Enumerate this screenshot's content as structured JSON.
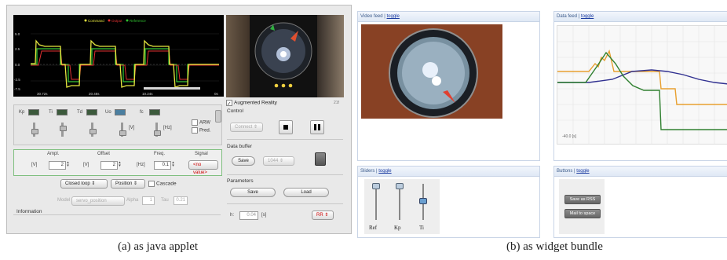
{
  "captions": {
    "left": "(a) as java applet",
    "right": "(b) as widget bundle"
  },
  "applet": {
    "scope": {
      "legend": [
        "Command",
        "Output",
        "Reference"
      ],
      "legend_colors": [
        "#e8e840",
        "#e03030",
        "#30c030"
      ],
      "y_ticks": [
        "5.0",
        "2.5",
        "0.0",
        "-2.5",
        "-5.0",
        "-7.5"
      ],
      "x_ticks": [
        "30.72s",
        "20.48s",
        "10.24s",
        "0s"
      ]
    },
    "augmented_reality_label": "Augmented Reality",
    "ar_value": "21f",
    "gains": {
      "labels": [
        "Kp",
        "Ti",
        "Td",
        "Uo",
        "fc"
      ],
      "units": [
        "[V]",
        "[Hz]"
      ],
      "checkboxes": [
        "ARW",
        "Pred."
      ]
    },
    "signal": {
      "headers": [
        "Ampl.",
        "Offset",
        "Freq.",
        "Signal"
      ],
      "units": [
        "[V]",
        "[V]",
        "[Hz]"
      ],
      "values": [
        "2",
        "2",
        "0.1"
      ],
      "signal_value": "<no value>"
    },
    "mode": {
      "loop": "Closed loop",
      "type": "Position",
      "cascade": "Cascade"
    },
    "model": {
      "label": "Model",
      "value": "servo_position",
      "alpha_label": "Alpha",
      "alpha_value": "1",
      "tau_label": "Tau",
      "tau_value": "0.21"
    },
    "information_label": "Information",
    "control": {
      "title": "Control",
      "connect": "Connect"
    },
    "data_buffer": {
      "title": "Data buffer",
      "save": "Save",
      "size": "1044"
    },
    "parameters": {
      "title": "Parameters",
      "save": "Save",
      "load": "Load"
    },
    "sampling": {
      "label": "h:",
      "value": "0.04",
      "unit": "[s]",
      "mode": "RR"
    }
  },
  "widgets": {
    "video": {
      "title": "Video feed",
      "toggle": "toggle"
    },
    "data": {
      "title": "Data feed",
      "toggle": "toggle",
      "x_label": "-40.0 [s]",
      "colors": [
        "#e8a030",
        "#303090",
        "#308030"
      ]
    },
    "sliders": {
      "title": "Sliders",
      "toggle": "toggle",
      "labels": [
        "Ref",
        "Kp",
        "Ti"
      ],
      "levels": [
        0.95,
        0.95,
        0.55
      ]
    },
    "buttons": {
      "title": "Buttons",
      "toggle": "toggle",
      "items": [
        "Save as RSS",
        "Mail to space"
      ]
    }
  }
}
